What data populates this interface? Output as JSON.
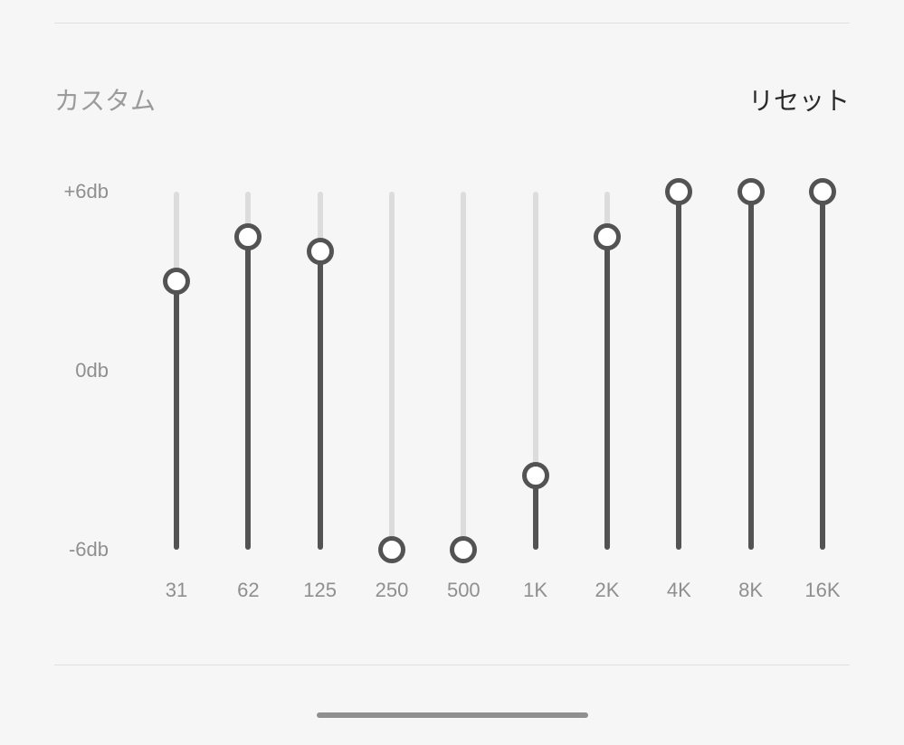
{
  "header": {
    "preset_label": "カスタム",
    "reset_label": "リセット"
  },
  "axis": {
    "top": "+6db",
    "mid": "0db",
    "bot": "-6db"
  },
  "bands": [
    {
      "freq_label": "31",
      "value": 3.0
    },
    {
      "freq_label": "62",
      "value": 4.5
    },
    {
      "freq_label": "125",
      "value": 4.0
    },
    {
      "freq_label": "250",
      "value": -6.0
    },
    {
      "freq_label": "500",
      "value": -6.0
    },
    {
      "freq_label": "1K",
      "value": -3.5
    },
    {
      "freq_label": "2K",
      "value": 4.5
    },
    {
      "freq_label": "4K",
      "value": 6.0
    },
    {
      "freq_label": "8K",
      "value": 6.0
    },
    {
      "freq_label": "16K",
      "value": 6.0
    }
  ],
  "range": {
    "min": -6,
    "max": 6
  }
}
